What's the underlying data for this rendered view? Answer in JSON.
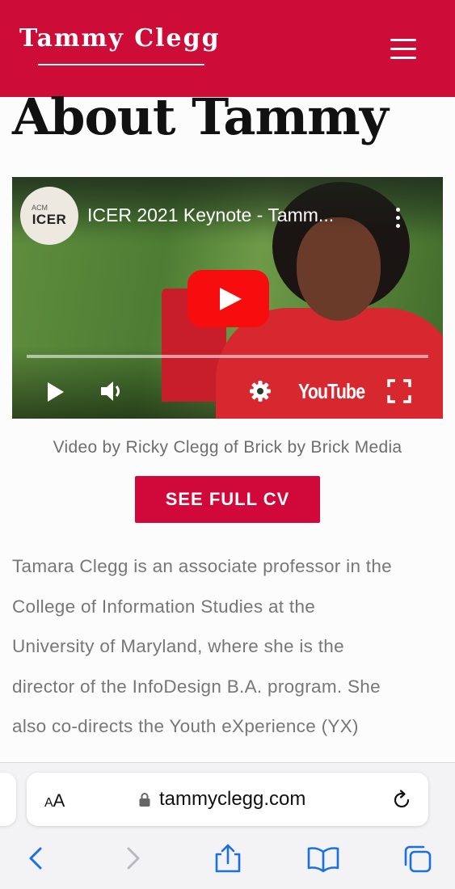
{
  "header": {
    "brand": "Tammy Clegg",
    "menu_icon": "hamburger-menu-icon",
    "background_color": "#ce0c38"
  },
  "page": {
    "title": "About Tammy"
  },
  "video": {
    "channel_logo_small": "ACM",
    "channel_logo": "ICER",
    "title": "ICER 2021 Keynote - Tamm...",
    "brand_wordmark": "YouTube",
    "icons": [
      "more-vert-icon",
      "play-button-icon",
      "play-icon",
      "volume-icon",
      "settings-gear-icon",
      "fullscreen-icon"
    ],
    "play_button_color": "#f70d0d"
  },
  "caption": "Video by Ricky Clegg of Brick by Brick Media",
  "cv_button": {
    "label": "SEE FULL CV",
    "color": "#d0093a"
  },
  "bio": {
    "lines": [
      "Tamara Clegg is an associate professor in the",
      "College of Information Studies at the",
      "University of Maryland, where she is the",
      "director of the InfoDesign B.A. program. She",
      "also co-directs the Youth eXperience (YX)"
    ]
  },
  "browser": {
    "text_size_button_small": "A",
    "text_size_button_large": "A",
    "url": "tammyclegg.com",
    "icons": [
      "lock-icon",
      "reload-icon",
      "back-chevron-icon",
      "forward-chevron-icon",
      "share-icon",
      "bookmarks-icon",
      "tabs-icon"
    ],
    "accent_color": "#1b6fe4"
  }
}
